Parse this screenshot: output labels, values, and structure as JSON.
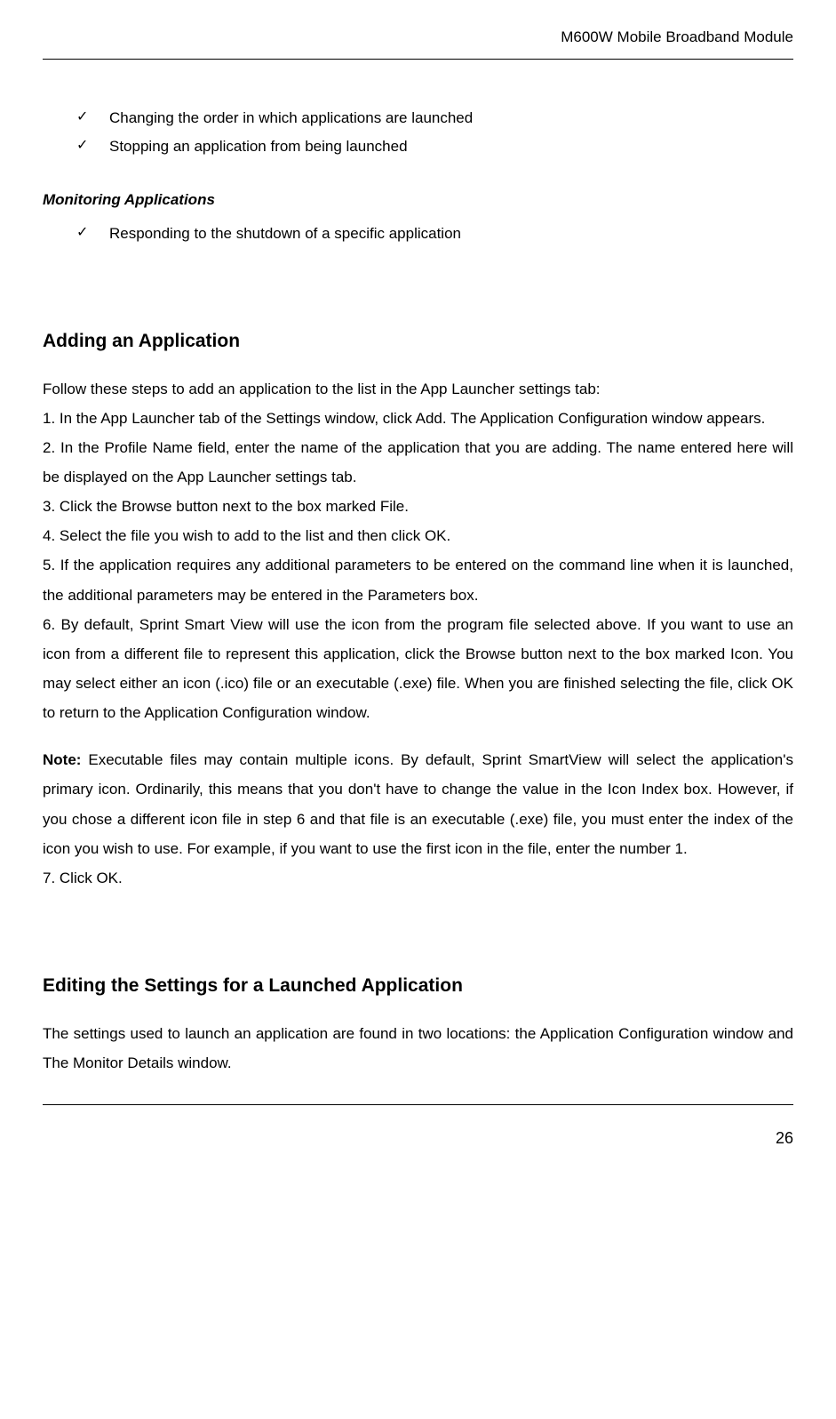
{
  "header": {
    "title": "M600W Mobile Broadband Module"
  },
  "bullets_top": [
    "Changing the order in which applications are launched",
    "Stopping an application from being launched"
  ],
  "monitoring": {
    "heading": "Monitoring Applications",
    "items": [
      "Responding to the shutdown of a specific application"
    ]
  },
  "adding": {
    "heading": "Adding an Application",
    "intro": "Follow these steps to add an application to the list in the App Launcher settings tab:",
    "step1": "1.   In the App Launcher tab of the Settings window, click Add. The Application Configuration window appears.",
    "step2": "2.    In the Profile Name field, enter the name of the application that you are adding. The name entered here will be displayed on the App Launcher settings tab.",
    "step3": "3.    Click the Browse button next to the box marked File.",
    "step4": "4.    Select the file you wish to add to the list and then click OK.",
    "step5": "5.   If the application requires any additional parameters to be entered on the command line when it is launched, the additional parameters may be entered in the Parameters box.",
    "step6": "6.    By default, Sprint Smart View will use the icon from the program file selected above. If you want to use an icon from a different file to represent this application, click the Browse button next to the box marked Icon. You may select either an icon (.ico) file or an executable (.exe) file. When you are finished selecting the file, click OK to return to the Application Configuration window.",
    "note_label": "Note:",
    "note_text": " Executable files may contain multiple icons. By default, Sprint SmartView will select the application's primary icon. Ordinarily, this means that you don't have to change the value in the Icon Index box. However, if you chose a different icon file in step 6 and that file is an executable (.exe) file, you must enter the index of the icon you wish to use. For example, if you want to use the first icon in the file, enter the number 1.",
    "step7": "7.    Click OK."
  },
  "editing": {
    "heading": "Editing the Settings for a Launched Application",
    "text": "The settings used to launch an application are found in two locations: the Application Configuration window and The Monitor Details window."
  },
  "footer": {
    "page_number": "26"
  }
}
